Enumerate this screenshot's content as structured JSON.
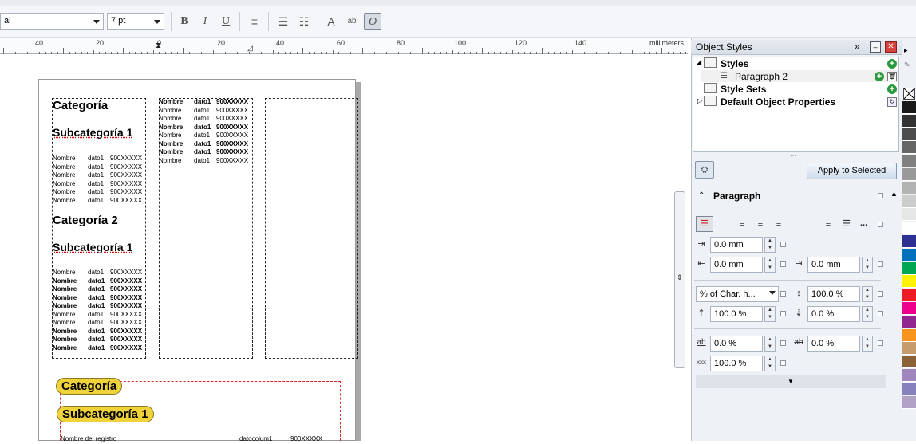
{
  "toolbar": {
    "font_name": "al",
    "font_size": "7 pt",
    "bold": "B",
    "italic": "I",
    "underline": "U",
    "active_tool": "O"
  },
  "ruler": {
    "unit": "millimeters",
    "labels": [
      "40",
      "20",
      "0",
      "20",
      "40",
      "60",
      "80",
      "100",
      "120",
      "140"
    ]
  },
  "document": {
    "block1": {
      "cat1": "Categoría",
      "sub1": "Subcategoría 1",
      "rows1": [
        [
          "Nombre",
          "dato1",
          "900XXXXX"
        ],
        [
          "Nombre",
          "dato1",
          "900XXXXX"
        ],
        [
          "Nombre",
          "dato1",
          "900XXXXX"
        ],
        [
          "Nombre",
          "dato1",
          "900XXXXX"
        ],
        [
          "Nombre",
          "dato1",
          "900XXXXX"
        ],
        [
          "Nombre",
          "dato1",
          "900XXXXX"
        ]
      ],
      "cat2": "Categoría 2",
      "sub2": "Subcategoría 1",
      "rows2": [
        [
          "Nombre",
          "dato1",
          "900XXXXX"
        ],
        [
          "Nombre",
          "dato1",
          "900XXXXX"
        ],
        [
          "Nombre",
          "dato1",
          "900XXXXX"
        ],
        [
          "Nombre",
          "dato1",
          "900XXXXX"
        ],
        [
          "Nombre",
          "dato1",
          "900XXXXX"
        ],
        [
          "Nombre",
          "dato1",
          "900XXXXX"
        ],
        [
          "Nombre",
          "dato1",
          "900XXXXX"
        ],
        [
          "Nombre",
          "dato1",
          "900XXXXX"
        ],
        [
          "Nombre",
          "dato1",
          "900XXXXX"
        ],
        [
          "Nombre",
          "dato1",
          "900XXXXX"
        ]
      ],
      "col2_rows": [
        [
          "Nombre",
          "dato1",
          "900XXXXX"
        ],
        [
          "Nombre",
          "dato1",
          "900XXXXX"
        ],
        [
          "Nombre",
          "dato1",
          "900XXXXX"
        ],
        [
          "Nombre",
          "dato1",
          "900XXXXX"
        ],
        [
          "Nombre",
          "dato1",
          "900XXXXX"
        ],
        [
          "Nombre",
          "dato1",
          "900XXXXX"
        ],
        [
          "Nombre",
          "dato1",
          "900XXXXX"
        ],
        [
          "Nombre",
          "dato1",
          "900XXXXX"
        ]
      ]
    },
    "block2": {
      "cat": "Categoría",
      "sub": "Subcategoría 1",
      "row": [
        "Nombre del registro",
        "datocolum1",
        "900XXXXX"
      ]
    }
  },
  "docker": {
    "title": "Object Styles",
    "tree": {
      "styles": "Styles",
      "paragraph2": "Paragraph 2",
      "style_sets": "Style Sets",
      "default_props": "Default Object Properties"
    },
    "apply_button": "Apply to Selected",
    "section_title": "Paragraph",
    "fields": {
      "first_line_indent": "0.0 mm",
      "left_indent": "0.0 mm",
      "right_indent": "0.0 mm",
      "line_spacing_unit": "% of Char. h...",
      "line_spacing": "100.0 %",
      "before_para": "100.0 %",
      "after_para": "0.0 %",
      "char_spacing": "0.0 %",
      "word_spacing": "0.0 %",
      "lang_spacing": "100.0 %"
    },
    "more": "..."
  },
  "palette": {
    "colors": [
      "#ffffff",
      "#1a1a1a",
      "#333333",
      "#4d4d4d",
      "#666666",
      "#808080",
      "#999999",
      "#b3b3b3",
      "#cccccc",
      "#e6e6e6",
      "#ffffff",
      "#2e3192",
      "#0072bc",
      "#00a651",
      "#fff200",
      "#ed1c24",
      "#ec008c",
      "#92278f",
      "#f7941d",
      "#c69c6d",
      "#8c6239",
      "#a186be",
      "#8781bd",
      "#b2a1c7"
    ]
  }
}
